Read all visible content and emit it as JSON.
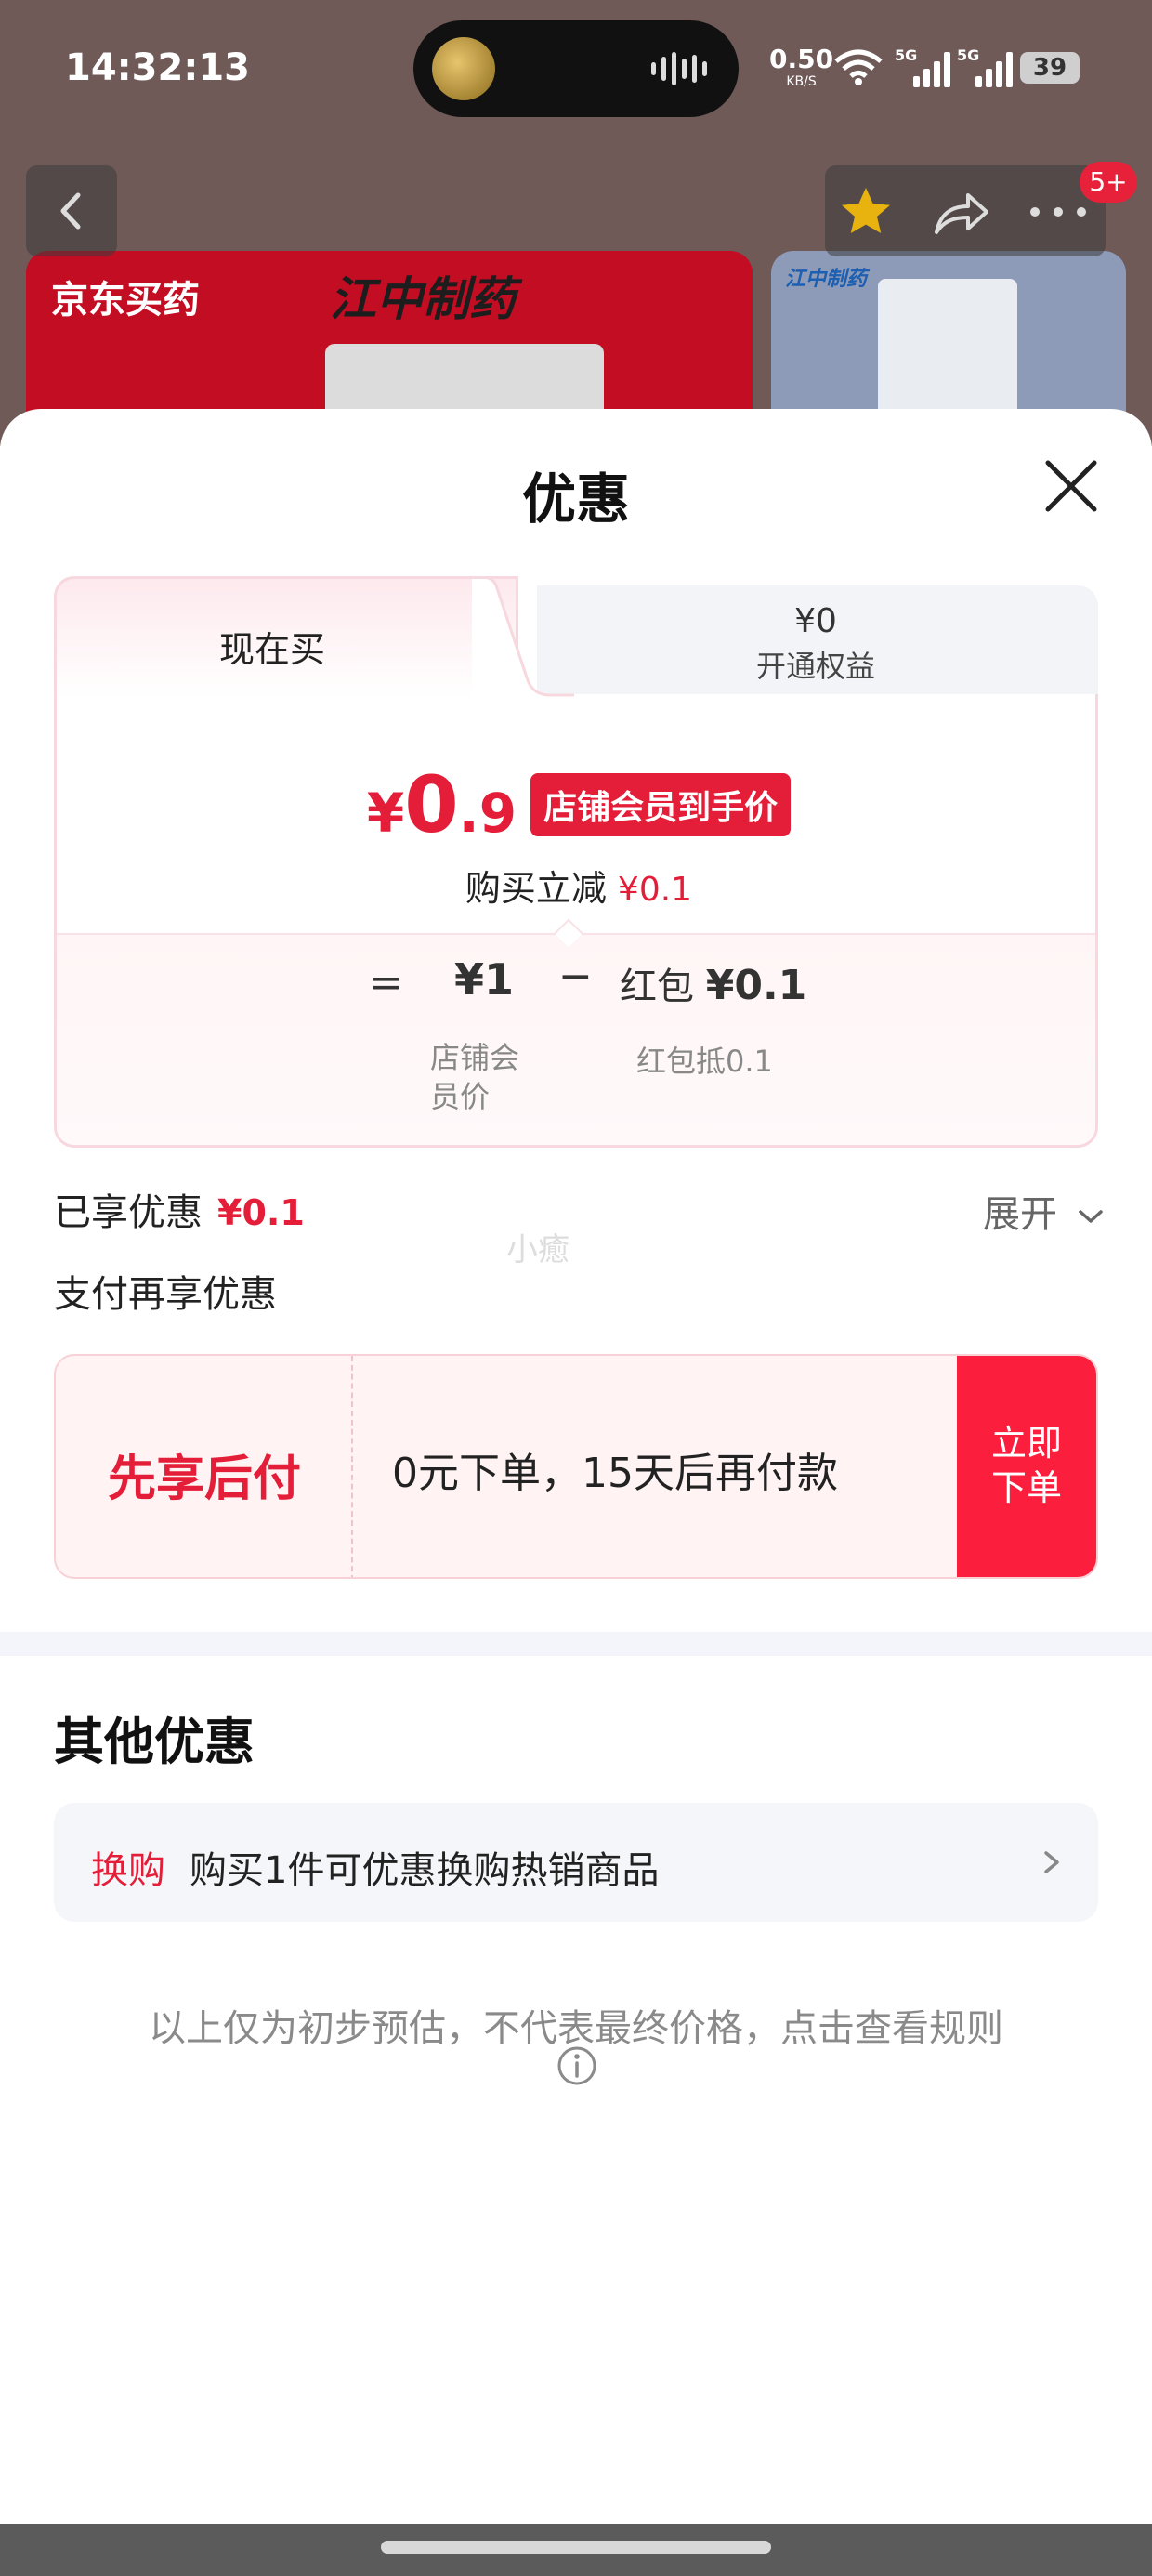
{
  "status_bar": {
    "time": "14:32:13",
    "net_speed": "0.50",
    "net_unit": "KB/S",
    "sim1": "5G",
    "sim2": "5G",
    "battery": "39"
  },
  "background_app": {
    "badge": "5+",
    "brand_left": "京东买药",
    "brand_right": "江中制药",
    "brand_small": "江中制药"
  },
  "sheet": {
    "title": "优惠",
    "tabs": {
      "active_label": "现在买",
      "inactive_price": "¥0",
      "inactive_label": "开通权益"
    },
    "price": {
      "yen": "¥",
      "int": "0",
      "dec": ".9",
      "tag": "店铺会员到手价"
    },
    "discount": {
      "label": "购买立减",
      "amount": "¥0.1"
    },
    "calc": {
      "equals": "=",
      "base_price": "¥1",
      "minus": "−",
      "redpacket_label": "红包",
      "redpacket_amount": "¥0.1",
      "base_caption": "店铺会员价",
      "redpacket_caption": "红包抵0.1"
    },
    "enjoyed": {
      "label": "已享优惠",
      "amount": "¥0.1"
    },
    "expand_label": "展开",
    "watermark": "小癒",
    "pay_more_label": "支付再享优惠",
    "bnpl": {
      "logo": "先享后付",
      "desc": "0元下单，15天后再付款",
      "button": "立即下单"
    },
    "other": {
      "title": "其他优惠",
      "tag": "换购",
      "text": "购买1件可优惠换购热销商品"
    },
    "disclaimer": "以上仅为初步预估，不代表最终价格，点击查看规则"
  },
  "colors": {
    "accent_red": "#e41e38",
    "button_red": "#fb1f3d",
    "card_border": "#f7d8de"
  }
}
